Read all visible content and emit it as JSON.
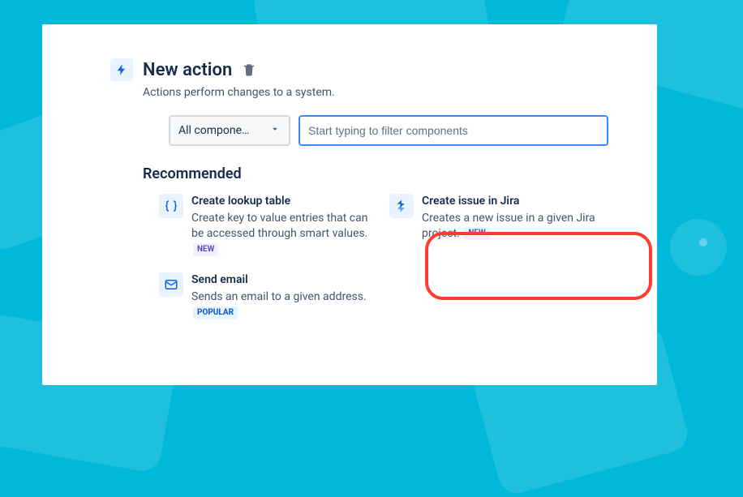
{
  "header": {
    "title": "New action",
    "subtitle": "Actions perform changes to a system."
  },
  "filter": {
    "select_label": "All compone…",
    "search_placeholder": "Start typing to filter components"
  },
  "section": {
    "recommended_title": "Recommended"
  },
  "cards": {
    "lookup": {
      "title": "Create lookup table",
      "desc": "Create key to value entries that can be accessed through smart values.",
      "badge": "NEW"
    },
    "jira": {
      "title": "Create issue in Jira",
      "desc": "Creates a new issue in a given Jira project.",
      "badge": "NEW"
    },
    "email": {
      "title": "Send email",
      "desc": "Sends an email to a given address.",
      "badge": "POPULAR"
    }
  }
}
